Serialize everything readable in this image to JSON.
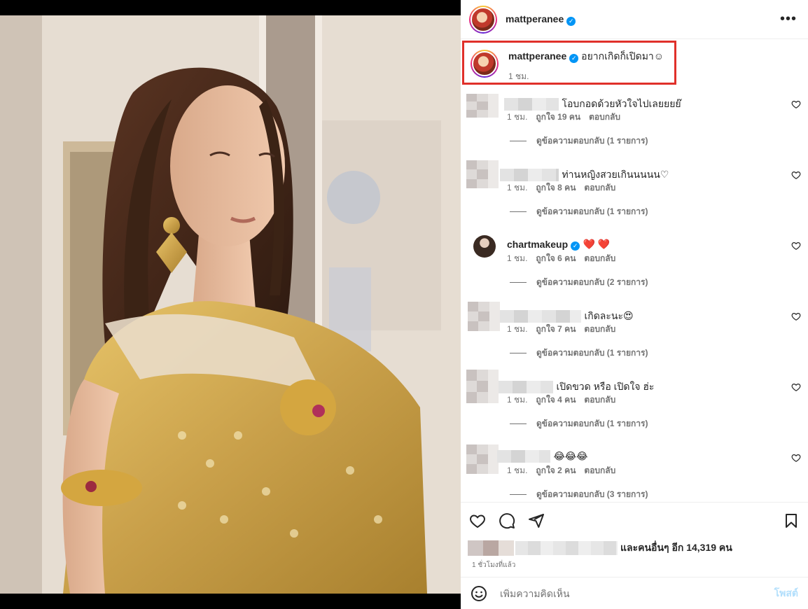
{
  "header": {
    "username": "mattperanee",
    "more_label": "•••"
  },
  "caption": {
    "username": "mattperanee",
    "text": "อยากเกิดก็เปิดมา☺",
    "time": "1 ชม."
  },
  "comments": [
    {
      "text": "โอบกอดด้วยหัวใจไปเลยยยย๊",
      "time": "1 ชม.",
      "likes": "ถูกใจ 19 คน",
      "reply": "ตอบกลับ",
      "view_replies": "ดูข้อความตอบกลับ (1 รายการ)"
    },
    {
      "text": "ท่านหญิงสวยเกินนนนน♡",
      "time": "1 ชม.",
      "likes": "ถูกใจ 8 คน",
      "reply": "ตอบกลับ",
      "view_replies": "ดูข้อความตอบกลับ (1 รายการ)"
    },
    {
      "username": "chartmakeup",
      "text": "❤️ ❤️",
      "time": "1 ชม.",
      "likes": "ถูกใจ 6 คน",
      "reply": "ตอบกลับ",
      "view_replies": "ดูข้อความตอบกลับ (2 รายการ)"
    },
    {
      "text": "เกิดละนะ😍",
      "time": "1 ชม.",
      "likes": "ถูกใจ 7 คน",
      "reply": "ตอบกลับ",
      "view_replies": "ดูข้อความตอบกลับ (1 รายการ)"
    },
    {
      "text": "เปิดขวด หรือ เปิดใจ ฮ่ะ ",
      "time": "1 ชม.",
      "likes": "ถูกใจ 4 คน",
      "reply": "ตอบกลับ",
      "view_replies": "ดูข้อความตอบกลับ (1 รายการ)"
    },
    {
      "text": "😂😂😂",
      "time": "1 ชม.",
      "likes": "ถูกใจ 2 คน",
      "reply": "ตอบกลับ",
      "view_replies": "ดูข้อความตอบกลับ (3 รายการ)"
    }
  ],
  "likes_summary": "และคนอื่นๆ อีก 14,319 คน",
  "post_time": "1 ชั่วโมงที่แล้ว",
  "comment_box": {
    "placeholder": "เพิ่มความคิดเห็น",
    "post_label": "โพสต์"
  },
  "colors": {
    "highlight_box": "#e0302a",
    "verified": "#0095f6",
    "heart_red": "#ed4956",
    "post_button_disabled": "#b2dffc"
  },
  "icons": [
    "heart-icon",
    "comment-icon",
    "share-icon",
    "bookmark-icon",
    "emoji-icon",
    "verified-badge-icon",
    "more-options-icon"
  ]
}
